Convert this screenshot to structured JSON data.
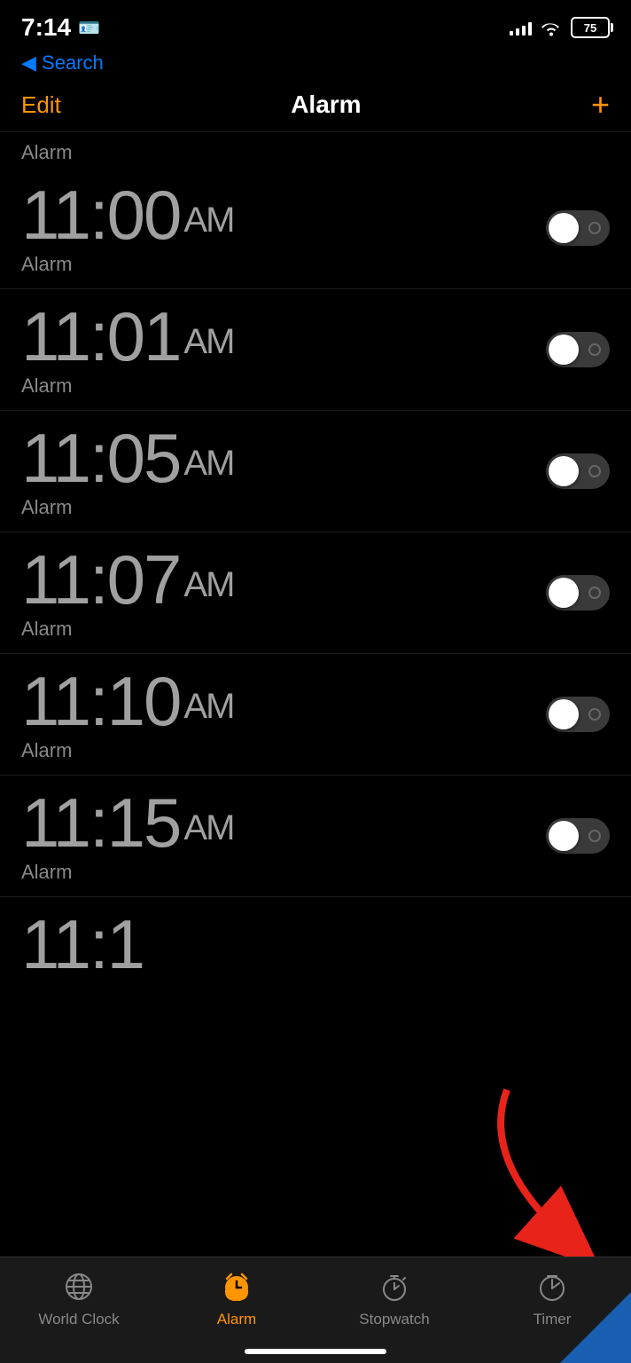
{
  "statusBar": {
    "time": "7:14",
    "batteryLevel": "75",
    "signal": [
      3,
      5,
      7,
      10,
      13
    ],
    "contactIcon": "📋"
  },
  "backNav": {
    "label": "◀ Search"
  },
  "navBar": {
    "editLabel": "Edit",
    "title": "Alarm",
    "addLabel": "+"
  },
  "sectionHeader": "Alarm",
  "alarms": [
    {
      "time": "11:00",
      "ampm": "AM",
      "label": "Alarm",
      "enabled": false
    },
    {
      "time": "11:01",
      "ampm": "AM",
      "label": "Alarm",
      "enabled": false
    },
    {
      "time": "11:05",
      "ampm": "AM",
      "label": "Alarm",
      "enabled": false
    },
    {
      "time": "11:07",
      "ampm": "AM",
      "label": "Alarm",
      "enabled": false
    },
    {
      "time": "11:10",
      "ampm": "AM",
      "label": "Alarm",
      "enabled": false
    },
    {
      "time": "11:15",
      "ampm": "AM",
      "label": "Alarm",
      "enabled": false
    }
  ],
  "partialAlarm": {
    "time": "11:1"
  },
  "tabBar": {
    "items": [
      {
        "id": "world-clock",
        "label": "World Clock",
        "active": false
      },
      {
        "id": "alarm",
        "label": "Alarm",
        "active": true
      },
      {
        "id": "stopwatch",
        "label": "Stopwatch",
        "active": false
      },
      {
        "id": "timer",
        "label": "Timer",
        "active": false
      }
    ]
  }
}
